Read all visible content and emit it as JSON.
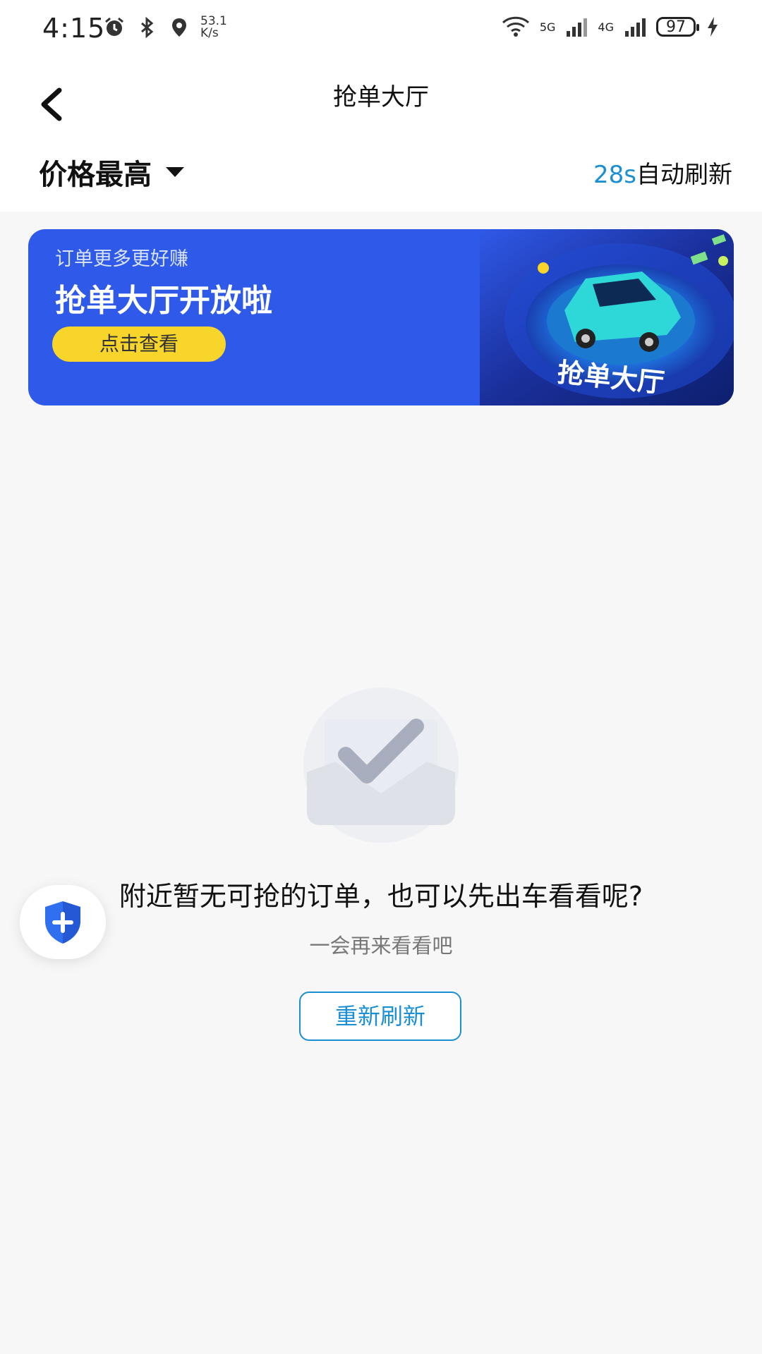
{
  "status_bar": {
    "time": "4:15",
    "speed_value": "53.1",
    "speed_unit": "K/s",
    "net_5g": "5G",
    "net_4g": "4G",
    "battery": "97",
    "icons": [
      "alarm-icon",
      "bluetooth-icon",
      "location-icon",
      "wifi-icon",
      "signal-icon",
      "signal-icon",
      "charging-icon"
    ]
  },
  "header": {
    "title": "抢单大厅",
    "sort_label": "价格最高",
    "refresh_count": "28s",
    "refresh_text": "自动刷新"
  },
  "banner": {
    "subtitle": "订单更多更好赚",
    "title": "抢单大厅开放啦",
    "button": "点击查看",
    "art_text": "抢单大厅"
  },
  "empty": {
    "title": "附近暂无可抢的订单，也可以先出车看看呢?",
    "subtitle": "一会再来看看吧",
    "refresh_button": "重新刷新"
  },
  "colors": {
    "accent": "#1a8fd4",
    "banner_bg": "#2f59e8",
    "banner_button": "#f7d52b"
  }
}
